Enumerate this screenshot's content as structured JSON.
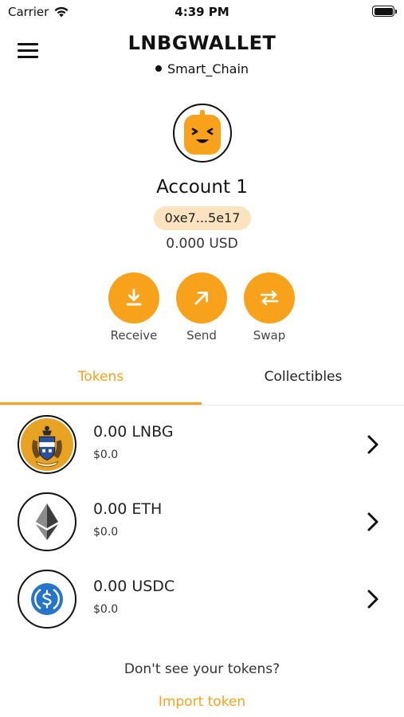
{
  "status_bar": {
    "carrier": "Carrier",
    "time": "4:39 PM"
  },
  "header": {
    "title": "LNBGWALLET",
    "network": "Smart_Chain"
  },
  "account": {
    "name": "Account 1",
    "address": "0xe7...5e17",
    "balance": "0.000 USD"
  },
  "actions": [
    {
      "label": "Receive",
      "icon": "download-icon"
    },
    {
      "label": "Send",
      "icon": "arrow-up-right-icon"
    },
    {
      "label": "Swap",
      "icon": "swap-arrows-icon"
    }
  ],
  "tabs": [
    {
      "label": "Tokens",
      "active": true
    },
    {
      "label": "Collectibles",
      "active": false
    }
  ],
  "tokens": [
    {
      "amount": "0.00 LNBG",
      "value": "$0.0",
      "icon": "lnbg-crest-icon"
    },
    {
      "amount": "0.00 ETH",
      "value": "$0.0",
      "icon": "ethereum-icon"
    },
    {
      "amount": "0.00 USDC",
      "value": "$0.0",
      "icon": "usdc-icon"
    }
  ],
  "footer": {
    "prompt": "Don't see your tokens?",
    "import_label": "Import token"
  },
  "colors": {
    "accent": "#f7a21a",
    "address_chip": "#fbe3bf",
    "avatar": "#f7a21a"
  }
}
